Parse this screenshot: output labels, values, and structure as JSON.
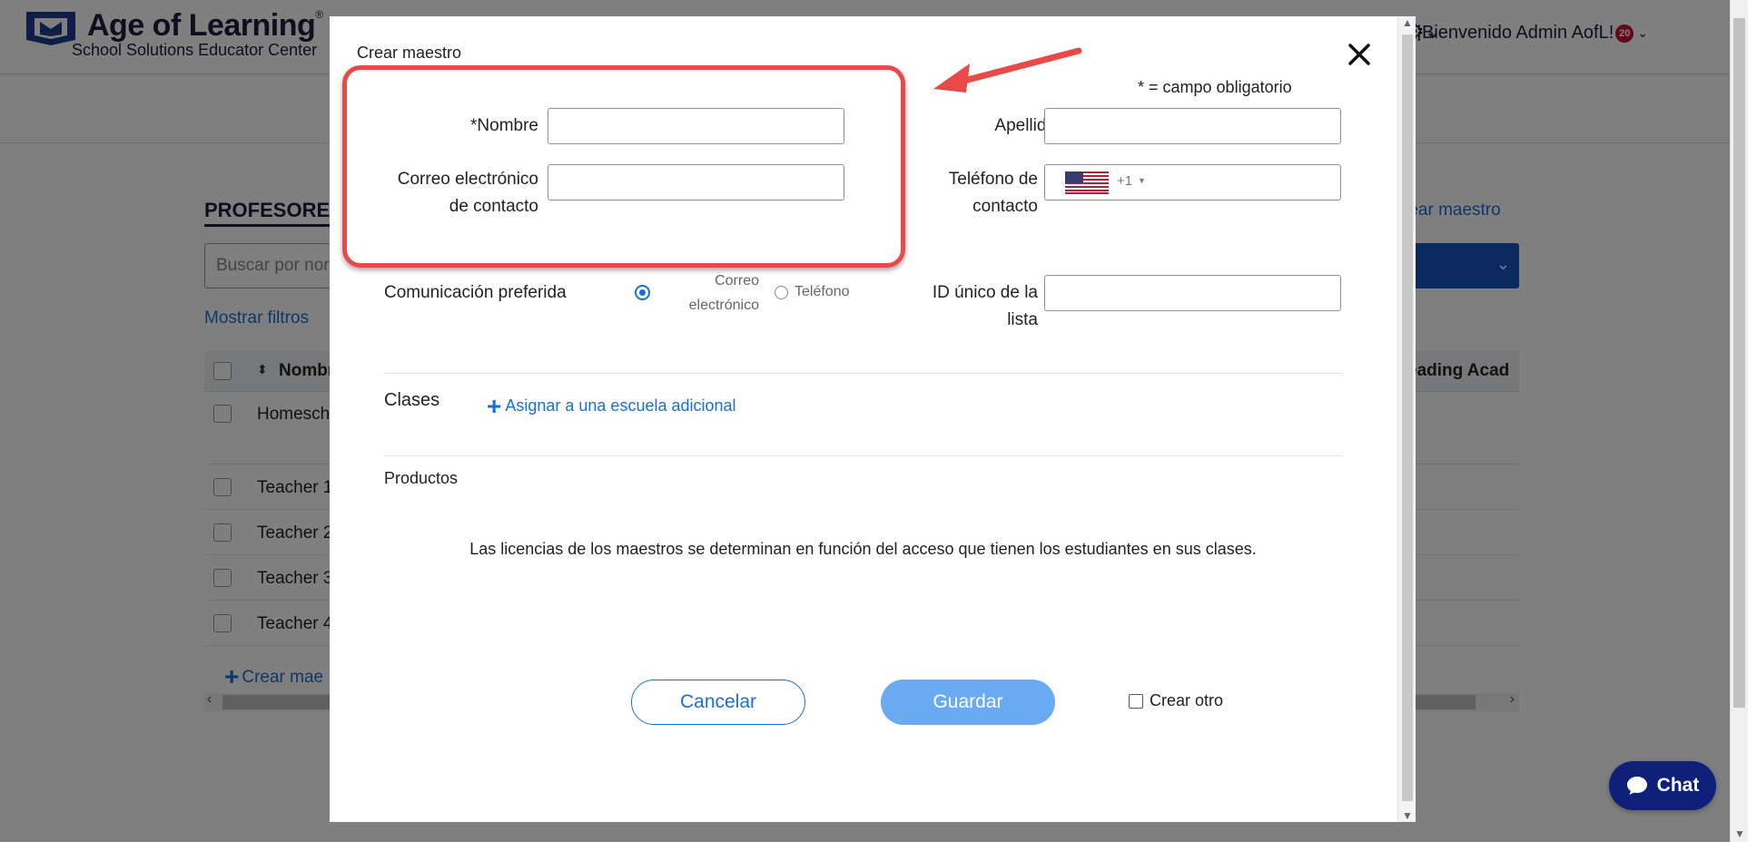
{
  "header": {
    "brand_name": "Age of Learning",
    "brand_reg": "®",
    "brand_subtitle": "School Solutions Educator Center",
    "welcome": "¡Bienvenido Admin AofL!",
    "notification_count": "20"
  },
  "background": {
    "tab": "PROFESORE",
    "search_placeholder": "Buscar por nor",
    "show_filters": "Mostrar filtros",
    "create_link": "rear maestro",
    "table": {
      "col_name": "Nombr",
      "col_reading": "eading Acad",
      "rows": [
        "Homesch",
        "Teacher 1",
        "Teacher 2",
        "Teacher 3",
        "Teacher 4"
      ]
    },
    "bottom_create": "Crear mae"
  },
  "modal": {
    "title": "Crear maestro",
    "required_note": "* = campo obligatorio",
    "first_name_label": "*Nombre",
    "first_name_value": "",
    "email_label": "Correo electrónico de contacto",
    "email_value": "",
    "last_name_label": "Apellido",
    "last_name_value": "",
    "phone_label": "Teléfono de contacto",
    "phone_code": "+1",
    "preferred_comm_label": "Comunicación preferida",
    "comm_option_email": "Correo electrónico",
    "comm_option_phone": "Teléfono",
    "list_id_label": "ID único de la lista",
    "list_id_value": "",
    "classes_title": "Clases",
    "assign_link": "Asignar a una escuela adicional",
    "products_title": "Productos",
    "license_text": "Las licencias de los maestros se determinan en función del acceso que tienen los estudiantes en sus clases.",
    "cancel_label": "Cancelar",
    "save_label": "Guardar",
    "create_another_label": "Crear otro"
  },
  "chat": {
    "label": "Chat"
  },
  "colors": {
    "accent": "#1a6fd6",
    "save_button": "#6aaaf2",
    "annotation_red": "#e84a4a",
    "chat_bg": "#0f1f7a"
  },
  "icons": [
    "logo-icon",
    "close-icon",
    "us-flag-icon",
    "plus-icon",
    "chat-bubble-icon",
    "chevron-down-icon"
  ]
}
